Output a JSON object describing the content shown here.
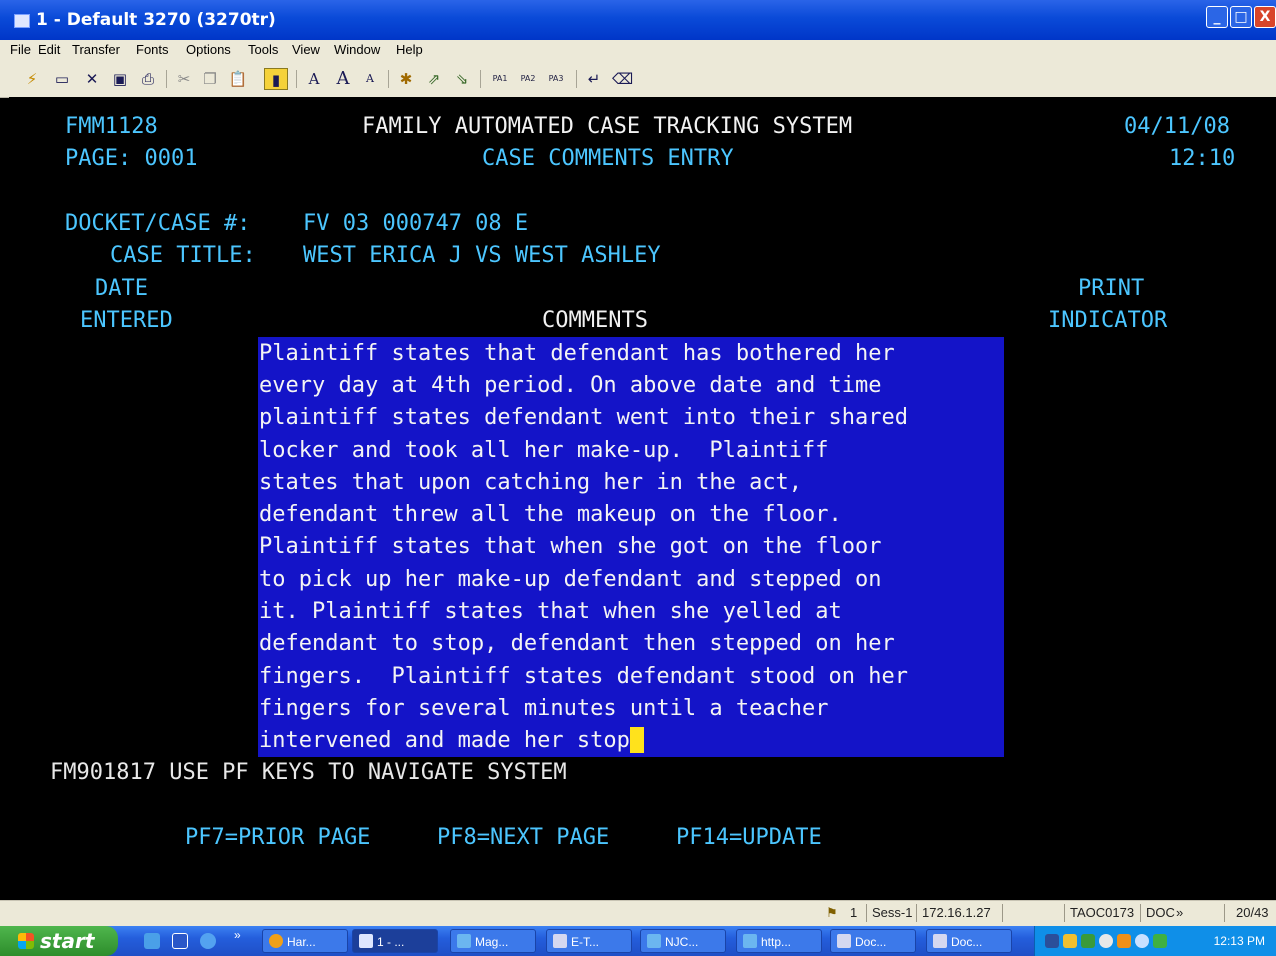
{
  "window": {
    "title": "1 - Default 3270 (3270tr)",
    "controls": {
      "minimize": "_",
      "maximize": "□",
      "close": "X"
    }
  },
  "menu": [
    "File",
    "Edit",
    "Transfer",
    "Fonts",
    "Options",
    "Tools",
    "View",
    "Window",
    "Help"
  ],
  "toolbar": {
    "pf_buttons": [
      "PA1",
      "PA2",
      "PA3"
    ],
    "icons": [
      "connect-icon",
      "print-screen-icon",
      "close-icon",
      "save-icon",
      "printer-icon",
      "cut-icon",
      "copy-icon",
      "paste-icon",
      "select-icon",
      "font-icon",
      "font-larger-icon",
      "font-smaller-icon",
      "settings-icon",
      "send-file-icon",
      "receive-file-icon",
      "enter-icon",
      "clear-icon"
    ]
  },
  "screen": {
    "program_id": "FMM1128",
    "system_title": "FAMILY AUTOMATED CASE TRACKING SYSTEM",
    "date": "04/11/08",
    "page_label": "PAGE: 0001",
    "screen_title": "CASE COMMENTS ENTRY",
    "time": "12:10",
    "docket_label": "DOCKET/CASE #:",
    "docket_value": "FV 03 000747 08 E",
    "case_title_label": "CASE TITLE:",
    "case_title_value": "WEST ERICA J VS WEST ASHLEY",
    "col_date_1": "DATE",
    "col_date_2": "ENTERED",
    "col_comments": "COMMENTS",
    "col_print_1": "PRINT",
    "col_print_2": "INDICATOR",
    "comment_lines": [
      "Plaintiff states that defendant has bothered her",
      "every day at 4th period. On above date and time",
      "plaintiff states defendant went into their shared",
      "locker and took all her make-up.  Plaintiff",
      "states that upon catching her in the act,",
      "defendant threw all the makeup on the floor.",
      "Plaintiff states that when she got on the floor",
      "to pick up her make-up defendant and stepped on",
      "it. Plaintiff states that when she yelled at",
      "defendant to stop, defendant then stepped on her",
      "fingers.  Plaintiff states defendant stood on her",
      "fingers for several minutes until a teacher",
      "intervened and made her stop"
    ],
    "message": "FM901817 USE PF KEYS TO NAVIGATE SYSTEM",
    "pf7": "PF7=PRIOR PAGE",
    "pf8": "PF8=NEXT PAGE",
    "pf14": "PF14=UPDATE"
  },
  "statusbar": {
    "count": "1",
    "session": "Sess-1",
    "host": "172.16.1.27",
    "lu": "TAOC0173",
    "mode": "DOC",
    "arrow": "»",
    "cursor_pos": "20/43"
  },
  "taskbar": {
    "start_label": "start",
    "more": "»",
    "tasks": [
      "Har...",
      "1 - ...",
      "Mag...",
      "E-T...",
      "NJC...",
      "http...",
      "Doc...",
      "Doc..."
    ],
    "clock": "12:13 PM"
  },
  "colors": {
    "terminal_bg": "#000000",
    "field_label": "#4cc6ff",
    "comment_bg": "#1414c8",
    "cursor": "#ffe21c",
    "title_bar": "#0a4ad8",
    "taskbar": "#245edc",
    "start_button": "#3c9a3a"
  }
}
